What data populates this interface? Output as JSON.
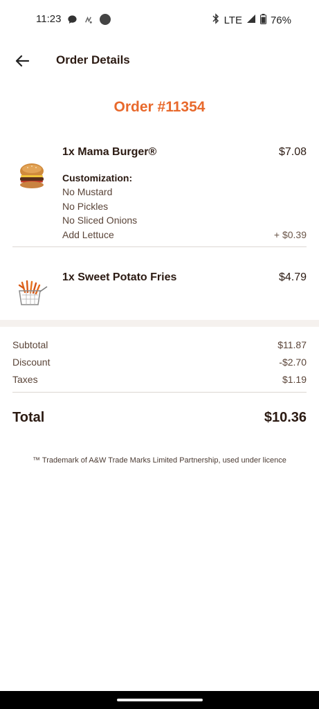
{
  "status_bar": {
    "time": "11:23",
    "network": "LTE",
    "battery": "76%",
    "left_icons": [
      "messages-icon",
      "gesture-icon",
      "dot-icon"
    ],
    "right_icons": [
      "bluetooth-icon",
      "signal-icon",
      "battery-icon"
    ]
  },
  "header": {
    "title": "Order Details"
  },
  "order": {
    "number": "Order #11354"
  },
  "items": [
    {
      "name": "1x Mama Burger®",
      "price": "$7.08",
      "image": "burger-image",
      "customization_label": "Customization:",
      "customizations": [
        {
          "text": "No Mustard",
          "price": ""
        },
        {
          "text": "No Pickles",
          "price": ""
        },
        {
          "text": "No Sliced Onions",
          "price": ""
        },
        {
          "text": "Add Lettuce",
          "price": "+ $0.39"
        }
      ]
    },
    {
      "name": "1x Sweet Potato Fries",
      "price": "$4.79",
      "image": "fries-image"
    }
  ],
  "summary": {
    "subtotal_label": "Subtotal",
    "subtotal": "$11.87",
    "discount_label": "Discount",
    "discount": "-$2.70",
    "taxes_label": "Taxes",
    "taxes": "$1.19",
    "total_label": "Total",
    "total": "$10.36"
  },
  "footer": {
    "trademark": "™ Trademark of A&W Trade Marks Limited Partnership, used under licence"
  },
  "colors": {
    "accent": "#e8692c",
    "text_dark": "#2b1a12",
    "text_muted": "#5a4438",
    "band": "#f5f1ee"
  }
}
